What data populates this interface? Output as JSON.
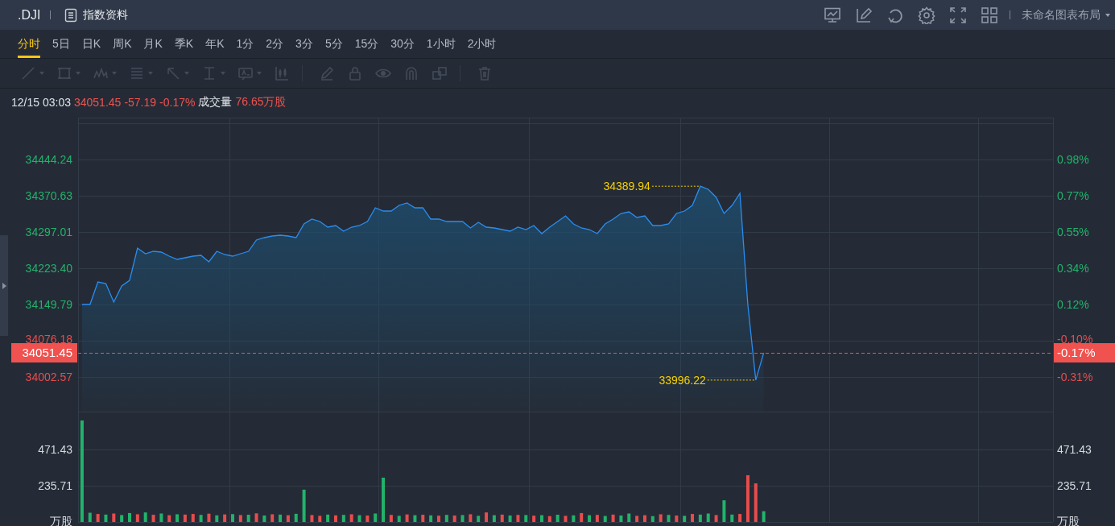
{
  "header": {
    "symbol": ".DJI",
    "info_link": "指数资料",
    "layout_name": "未命名图表布局"
  },
  "period_tabs": [
    {
      "label": "分时",
      "selected": true
    },
    {
      "label": "5日",
      "selected": false
    },
    {
      "label": "日K",
      "selected": false
    },
    {
      "label": "周K",
      "selected": false
    },
    {
      "label": "月K",
      "selected": false
    },
    {
      "label": "季K",
      "selected": false
    },
    {
      "label": "年K",
      "selected": false
    },
    {
      "label": "1分",
      "selected": false
    },
    {
      "label": "2分",
      "selected": false
    },
    {
      "label": "3分",
      "selected": false
    },
    {
      "label": "5分",
      "selected": false
    },
    {
      "label": "15分",
      "selected": false
    },
    {
      "label": "30分",
      "selected": false
    },
    {
      "label": "1小时",
      "selected": false
    },
    {
      "label": "2小时",
      "selected": false
    }
  ],
  "drawing_toolbar": {
    "disabled": true
  },
  "quote_line": {
    "time": "12/15 03:03",
    "price": "34051.45",
    "change": "-57.19",
    "percent": "-0.17%",
    "volume_label": "成交量",
    "volume": "76.65万股"
  },
  "price_pane": {
    "percent_ticks": [
      {
        "label": "0.98%",
        "color": "#21b36b"
      },
      {
        "label": "0.77%",
        "color": "#21b36b"
      },
      {
        "label": "0.55%",
        "color": "#21b36b"
      },
      {
        "label": "0.34%",
        "color": "#21b36b"
      },
      {
        "label": "0.12%",
        "color": "#21b36b"
      },
      {
        "label": "-0.10%",
        "color": "#e84c4c"
      },
      {
        "label": "-0.31%",
        "color": "#e84c4c"
      }
    ],
    "last_price": {
      "label": "34051.45",
      "percent": "-0.17%"
    },
    "high_label": "34389.94",
    "low_label": "33996.22",
    "chart_data": {
      "type": "area",
      "ylim": [
        33930.6,
        34534.21
      ],
      "grid": true,
      "ref_lines": [
        {
          "axis": "y",
          "value": 34051.45,
          "color": "#f0524f"
        }
      ],
      "yticks": [
        {
          "value": 34444.24,
          "label": "34444.24"
        },
        {
          "value": 34370.63,
          "label": "34370.63"
        },
        {
          "value": 34297.01,
          "label": "34297.01"
        },
        {
          "value": 34223.4,
          "label": "34223.40"
        },
        {
          "value": 34149.79,
          "label": "34149.79"
        },
        {
          "value": 34076.18,
          "label": "34076.18"
        },
        {
          "value": 34002.57,
          "label": "34002.57"
        }
      ],
      "categories": [
        null,
        null,
        null,
        null,
        null,
        null,
        null,
        null,
        null,
        null,
        null,
        null,
        null,
        null,
        null,
        null,
        null,
        null,
        null,
        null,
        null,
        null,
        null,
        null,
        null,
        null,
        null,
        null,
        null,
        null,
        null,
        null,
        null,
        null,
        null,
        null,
        null,
        null,
        null,
        null,
        null,
        null,
        null,
        null,
        null,
        null,
        null,
        null,
        null,
        null,
        null,
        null,
        null,
        null,
        null,
        null,
        null,
        null,
        null,
        null,
        null,
        null,
        null,
        null,
        null,
        null,
        null,
        null,
        null,
        null,
        null,
        null,
        null,
        null,
        null,
        null,
        null,
        null,
        null,
        null,
        null,
        null,
        null,
        null,
        null,
        null,
        null,
        null,
        null,
        null,
        null,
        null,
        null,
        null,
        null,
        null,
        null,
        null,
        null,
        null,
        null,
        null,
        null,
        null,
        null,
        null,
        null,
        null,
        null,
        null,
        null,
        null,
        null,
        null,
        null,
        null,
        null,
        null,
        null,
        null,
        null,
        null,
        null
      ],
      "series": [
        {
          "color": "#2a8df0",
          "values": [
            34149.8,
            34149.8,
            34195.6,
            34192.33,
            34154.7,
            34187.42,
            34198.87,
            34264.3,
            34252.85,
            34257.76,
            34256.12,
            34247.94,
            34241.4,
            34244.67,
            34247.94,
            34249.58,
            34236.49,
            34257.76,
            34251.22,
            34247.94,
            34252.85,
            34257.76,
            34280.66,
            34285.57,
            34288.84,
            34290.47,
            34288.84,
            34285.57,
            34313.38,
            34323.19,
            34318.28,
            34306.83,
            34310.1,
            34298.65,
            34306.83,
            34310.1,
            34318.28,
            34346.09,
            34339.55,
            34339.55,
            34351.0,
            34355.91,
            34346.09,
            34346.09,
            34323.19,
            34323.19,
            34318.28,
            34318.28,
            34318.28,
            34305.2,
            34316.65,
            34306.83,
            34305.2,
            34301.93,
            34298.65,
            34306.83,
            34301.93,
            34310.1,
            34293.75,
            34306.83,
            34318.28,
            34329.73,
            34313.38,
            34305.2,
            34301.93,
            34293.75,
            34313.38,
            34323.19,
            34334.64,
            34337.91,
            34326.46,
            34329.73,
            34310.1,
            34310.1,
            34313.38,
            34334.64,
            34339.55,
            34351.0,
            34389.94,
            34383.72,
            34367.36,
            34334.64,
            34351.0,
            34375.54,
            34149.8,
            33996.22,
            34051.45,
            null,
            null,
            null,
            null,
            null,
            null,
            null,
            null,
            null,
            null,
            null,
            null,
            null,
            null,
            null,
            null,
            null,
            null,
            null,
            null,
            null,
            null,
            null,
            null,
            null,
            null,
            null,
            null,
            null,
            null,
            null,
            null,
            null,
            null,
            null,
            null
          ]
        }
      ]
    }
  },
  "volume_pane": {
    "left_unit": "万股",
    "right_unit": "万股",
    "right_ticks": [
      "471.43",
      "235.71"
    ],
    "chart_data": {
      "type": "bar",
      "ylim": [
        0,
        712.36
      ],
      "grid": true,
      "yticks": [
        {
          "value": 471.43,
          "label": "471.43"
        },
        {
          "value": 235.71,
          "label": "235.71"
        }
      ],
      "stacked": true,
      "categories": [
        null,
        null,
        null,
        null,
        null,
        null,
        null,
        null,
        null,
        null,
        null,
        null,
        null,
        null,
        null,
        null,
        null,
        null,
        null,
        null,
        null,
        null,
        null,
        null,
        null,
        null,
        null,
        null,
        null,
        null,
        null,
        null,
        null,
        null,
        null,
        null,
        null,
        null,
        null,
        null,
        null,
        null,
        null,
        null,
        null,
        null,
        null,
        null,
        null,
        null,
        null,
        null,
        null,
        null,
        null,
        null,
        null,
        null,
        null,
        null,
        null,
        null,
        null,
        null,
        null,
        null,
        null,
        null,
        null,
        null,
        null,
        null,
        null,
        null,
        null,
        null,
        null,
        null,
        null,
        null,
        null,
        null,
        null,
        null,
        null,
        null,
        null,
        null,
        null,
        null,
        null,
        null,
        null,
        null,
        null,
        null,
        null,
        null,
        null,
        null,
        null,
        null,
        null,
        null,
        null,
        null,
        null,
        null,
        null,
        null,
        null,
        null,
        null,
        null,
        null,
        null,
        null,
        null,
        null,
        null,
        null,
        null,
        null
      ],
      "series": [
        {
          "color": "#e84c4c",
          "values": [
            0,
            0,
            52,
            0,
            55,
            0,
            0,
            50,
            0,
            47,
            0,
            44,
            0,
            48,
            52,
            0,
            54,
            0,
            49,
            0,
            45,
            0,
            56,
            0,
            50,
            0,
            44,
            0,
            0,
            45,
            40,
            0,
            43,
            0,
            50,
            0,
            42,
            0,
            0,
            46,
            0,
            49,
            0,
            47,
            0,
            41,
            0,
            42,
            0,
            50,
            0,
            62,
            0,
            48,
            0,
            46,
            0,
            41,
            0,
            38,
            0,
            40,
            0,
            58,
            0,
            46,
            0,
            48,
            0,
            0,
            40,
            44,
            0,
            50,
            0,
            42,
            0,
            52,
            0,
            0,
            45,
            0,
            0,
            52,
            304,
            251,
            0,
            null,
            null,
            null,
            null,
            null,
            null,
            null,
            null,
            null,
            null,
            null,
            null,
            null,
            null,
            null,
            null,
            null,
            null,
            null,
            null,
            null,
            null,
            null,
            null,
            null,
            null,
            null,
            null,
            null,
            null,
            null,
            null,
            null,
            null,
            null,
            null
          ]
        },
        {
          "color": "#21b36b",
          "values": [
            660,
            60,
            0,
            48,
            0,
            45,
            58,
            0,
            62,
            0,
            55,
            0,
            50,
            0,
            0,
            46,
            0,
            43,
            0,
            51,
            0,
            47,
            0,
            42,
            0,
            48,
            0,
            53,
            210,
            0,
            0,
            48,
            0,
            46,
            0,
            44,
            0,
            55,
            288,
            0,
            40,
            0,
            44,
            0,
            43,
            0,
            46,
            0,
            45,
            0,
            40,
            0,
            44,
            0,
            42,
            0,
            45,
            0,
            44,
            0,
            47,
            0,
            43,
            0,
            44,
            0,
            39,
            0,
            42,
            55,
            0,
            0,
            38,
            0,
            46,
            0,
            40,
            0,
            48,
            55,
            0,
            141,
            48,
            0,
            0,
            0,
            70,
            null,
            null,
            null,
            null,
            null,
            null,
            null,
            null,
            null,
            null,
            null,
            null,
            null,
            null,
            null,
            null,
            null,
            null,
            null,
            null,
            null,
            null,
            null,
            null,
            null,
            null,
            null,
            null,
            null,
            null,
            null,
            null,
            null,
            null,
            null,
            null
          ]
        }
      ]
    }
  }
}
